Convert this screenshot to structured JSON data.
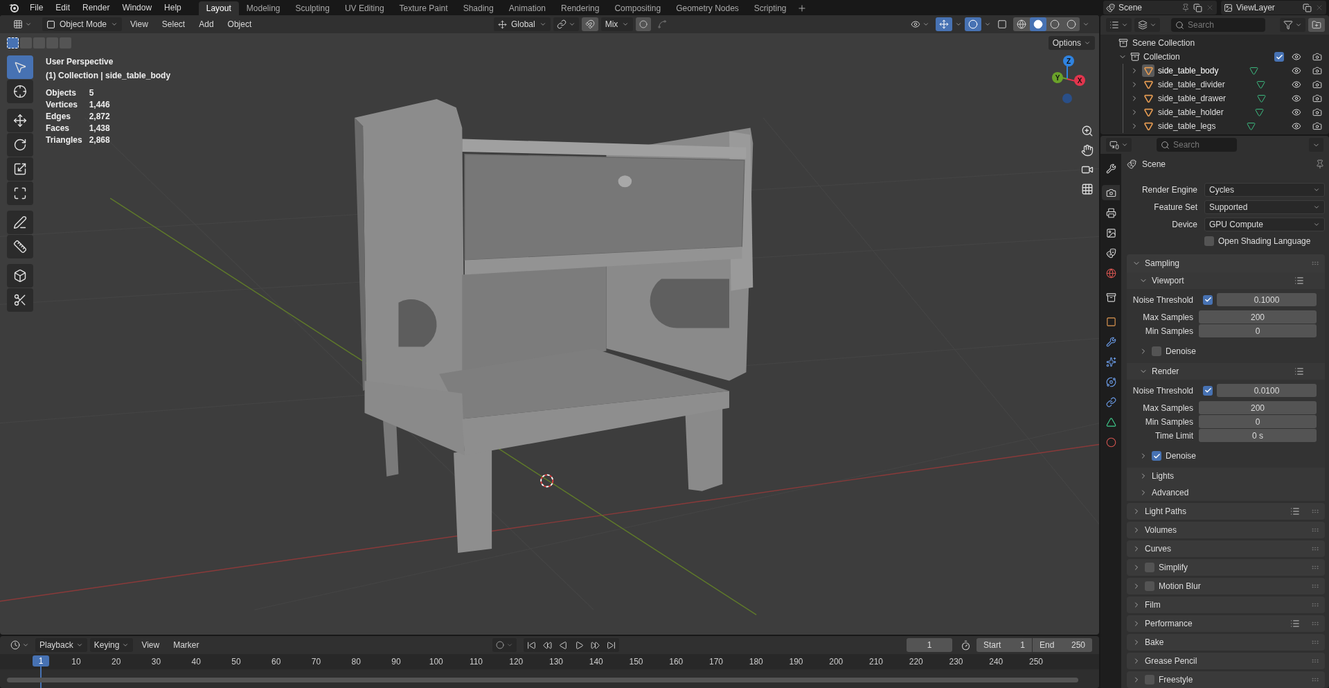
{
  "menu": [
    "File",
    "Edit",
    "Render",
    "Window",
    "Help"
  ],
  "workspaces": [
    {
      "label": "Layout",
      "selected": true
    },
    {
      "label": "Modeling",
      "selected": false
    },
    {
      "label": "Sculpting",
      "selected": false
    },
    {
      "label": "UV Editing",
      "selected": false
    },
    {
      "label": "Texture Paint",
      "selected": false
    },
    {
      "label": "Shading",
      "selected": false
    },
    {
      "label": "Animation",
      "selected": false
    },
    {
      "label": "Rendering",
      "selected": false
    },
    {
      "label": "Compositing",
      "selected": false
    },
    {
      "label": "Geometry Nodes",
      "selected": false
    },
    {
      "label": "Scripting",
      "selected": false
    }
  ],
  "scene_selector": "Scene",
  "view_layer": "ViewLayer",
  "viewport_header": {
    "mode": "Object Mode",
    "menus": [
      "View",
      "Select",
      "Add",
      "Object"
    ],
    "orientation": "Global",
    "snap_target": "Mix",
    "options": "Options"
  },
  "selection_modes": [
    {
      "selected": true
    },
    {
      "selected": false
    },
    {
      "selected": false
    },
    {
      "selected": false
    },
    {
      "selected": false
    }
  ],
  "tool_groups": [
    [
      {
        "kind": "select",
        "selected": true
      },
      {
        "kind": "cursor",
        "selected": false
      }
    ],
    [
      {
        "kind": "move",
        "selected": false
      },
      {
        "kind": "rotate",
        "selected": false
      },
      {
        "kind": "scale",
        "selected": false
      },
      {
        "kind": "transform",
        "selected": false
      }
    ],
    [
      {
        "kind": "annotate",
        "selected": false
      },
      {
        "kind": "measure",
        "selected": false
      }
    ],
    [
      {
        "kind": "add_cube",
        "selected": false
      },
      {
        "kind": "knife",
        "selected": false
      }
    ]
  ],
  "viewport": {
    "title": "User Perspective",
    "context": "(1) Collection | side_table_body",
    "stats": [
      {
        "label": "Objects",
        "value": "5"
      },
      {
        "label": "Vertices",
        "value": "1,446"
      },
      {
        "label": "Edges",
        "value": "2,872"
      },
      {
        "label": "Faces",
        "value": "1,438"
      },
      {
        "label": "Triangles",
        "value": "2,868"
      }
    ],
    "gizmo_axes": [
      {
        "label": "Z",
        "color": "#2f83e0"
      },
      {
        "label": "Y",
        "color": "#6aa22a"
      },
      {
        "label": "X",
        "color": "#e2354d"
      }
    ]
  },
  "outliner": {
    "search_placeholder": "Search",
    "root": "Scene Collection",
    "collection": {
      "name": "Collection",
      "expanded": true,
      "checked": true,
      "visible": true,
      "renderable": true,
      "children": [
        {
          "name": "side_table_body",
          "selected": true,
          "expanded": false,
          "visible": true,
          "renderable": true
        },
        {
          "name": "side_table_divider",
          "selected": false,
          "expanded": false,
          "visible": true,
          "renderable": true
        },
        {
          "name": "side_table_drawer",
          "selected": false,
          "expanded": false,
          "visible": true,
          "renderable": true
        },
        {
          "name": "side_table_holder",
          "selected": false,
          "expanded": false,
          "visible": true,
          "renderable": true
        },
        {
          "name": "side_table_legs",
          "selected": false,
          "expanded": false,
          "visible": true,
          "renderable": true
        }
      ]
    }
  },
  "properties": {
    "search_placeholder": "Search",
    "context": "Scene",
    "tabs": [
      {
        "kind": "tool",
        "selected": false
      },
      {
        "kind": "render",
        "selected": true
      },
      {
        "kind": "output",
        "selected": false
      },
      {
        "kind": "view_layer",
        "selected": false
      },
      {
        "kind": "scene",
        "selected": false
      },
      {
        "kind": "world",
        "selected": false
      },
      {
        "kind": "collection",
        "selected": false
      },
      {
        "kind": "object",
        "selected": false
      },
      {
        "kind": "modifiers",
        "selected": false
      },
      {
        "kind": "particles",
        "selected": false
      },
      {
        "kind": "physics",
        "selected": false
      },
      {
        "kind": "constraints",
        "selected": false
      },
      {
        "kind": "data",
        "selected": false
      },
      {
        "kind": "material",
        "selected": false
      }
    ],
    "fields": [
      {
        "label": "Render Engine",
        "value": "Cycles"
      },
      {
        "label": "Feature Set",
        "value": "Supported"
      },
      {
        "label": "Device",
        "value": "GPU Compute"
      }
    ],
    "osl": {
      "label": "Open Shading Language",
      "checked": false
    },
    "sampling": {
      "title": "Sampling",
      "expanded": true,
      "subpanels": [
        {
          "title": "Viewport",
          "expanded": true,
          "rows": [
            {
              "kind": "check_number",
              "label": "Noise Threshold",
              "checked": true,
              "value": "0.1000"
            },
            {
              "kind": "number",
              "label": "Max Samples",
              "value": "200"
            },
            {
              "kind": "number",
              "label": "Min Samples",
              "value": "0"
            }
          ],
          "denoise": {
            "label": "Denoise",
            "checked": false
          }
        },
        {
          "title": "Render",
          "expanded": true,
          "rows": [
            {
              "kind": "check_number",
              "label": "Noise Threshold",
              "checked": true,
              "value": "0.0100"
            },
            {
              "kind": "number",
              "label": "Max Samples",
              "value": "200"
            },
            {
              "kind": "number",
              "label": "Min Samples",
              "value": "0"
            },
            {
              "kind": "number",
              "label": "Time Limit",
              "value": "0 s"
            }
          ],
          "denoise": {
            "label": "Denoise",
            "checked": true
          }
        }
      ],
      "closed": [
        {
          "title": "Lights",
          "expanded": false
        },
        {
          "title": "Advanced",
          "expanded": false
        }
      ]
    },
    "panels": [
      {
        "title": "Light Paths",
        "kind": "plain",
        "presets": true
      },
      {
        "title": "Volumes",
        "kind": "plain",
        "presets": false
      },
      {
        "title": "Curves",
        "kind": "plain",
        "presets": false
      },
      {
        "title": "Simplify",
        "kind": "toggle",
        "checked": false,
        "presets": false
      },
      {
        "title": "Motion Blur",
        "kind": "toggle",
        "checked": false,
        "presets": false
      },
      {
        "title": "Film",
        "kind": "plain",
        "presets": false
      },
      {
        "title": "Performance",
        "kind": "plain",
        "presets": true
      },
      {
        "title": "Bake",
        "kind": "plain",
        "presets": false
      },
      {
        "title": "Grease Pencil",
        "kind": "plain",
        "presets": false
      },
      {
        "title": "Freestyle",
        "kind": "toggle",
        "checked": false,
        "presets": false
      }
    ]
  },
  "timeline": {
    "menus": [
      "Playback",
      "Keying",
      "View",
      "Marker"
    ],
    "current_frame": "1",
    "start_label": "Start",
    "start": "1",
    "end_label": "End",
    "end": "250",
    "playhead": "1",
    "ticks": [
      "10",
      "20",
      "30",
      "40",
      "50",
      "60",
      "70",
      "80",
      "90",
      "100",
      "110",
      "120",
      "130",
      "140",
      "150",
      "160",
      "170",
      "180",
      "190",
      "200",
      "210",
      "220",
      "230",
      "240",
      "250"
    ]
  }
}
